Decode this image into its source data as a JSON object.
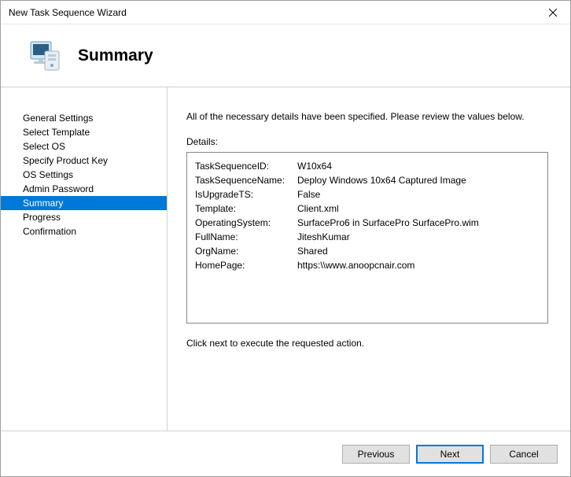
{
  "window": {
    "title": "New Task Sequence Wizard"
  },
  "header": {
    "title": "Summary"
  },
  "sidebar": {
    "items": [
      {
        "label": "General Settings",
        "selected": false
      },
      {
        "label": "Select Template",
        "selected": false
      },
      {
        "label": "Select OS",
        "selected": false
      },
      {
        "label": "Specify Product Key",
        "selected": false
      },
      {
        "label": "OS Settings",
        "selected": false
      },
      {
        "label": "Admin Password",
        "selected": false
      },
      {
        "label": "Summary",
        "selected": true
      },
      {
        "label": "Progress",
        "selected": false
      },
      {
        "label": "Confirmation",
        "selected": false
      }
    ]
  },
  "content": {
    "instruction": "All of the necessary details have been specified.  Please review the values below.",
    "details_label": "Details:",
    "details": [
      {
        "key": "TaskSequenceID:",
        "value": "W10x64"
      },
      {
        "key": "TaskSequenceName:",
        "value": "Deploy Windows 10x64 Captured Image"
      },
      {
        "key": "IsUpgradeTS:",
        "value": "False"
      },
      {
        "key": "Template:",
        "value": "Client.xml"
      },
      {
        "key": "OperatingSystem:",
        "value": "SurfacePro6 in SurfacePro SurfacePro.wim"
      },
      {
        "key": "FullName:",
        "value": "JiteshKumar"
      },
      {
        "key": "OrgName:",
        "value": "Shared"
      },
      {
        "key": "HomePage:",
        "value": "https:\\\\www.anoopcnair.com"
      }
    ],
    "footer_instruction": "Click next to execute the requested action."
  },
  "buttons": {
    "previous": "Previous",
    "next": "Next",
    "cancel": "Cancel"
  }
}
